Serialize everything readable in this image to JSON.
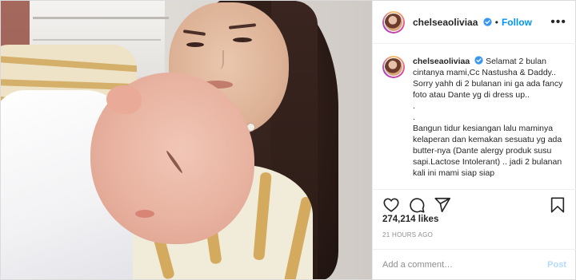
{
  "post": {
    "username": "chelseaoliviaa",
    "verified": true,
    "follow_label": "Follow",
    "separator": "•",
    "more_label": "•••",
    "caption_username": "chelseaoliviaa",
    "caption_text": "Selamat 2 bulan cintanya mami,Cc Nastusha & Daddy.. Sorry yahh di 2 bulanan ini ga ada fancy foto atau Dante yg di dress up..\n.\n.\nBangun tidur kesiangan lalu maminya kelaperan dan kemakan sesuatu yg ada butter-nya (Dante alergy produk susu sapi.Lactose Intolerant) .. jadi 2 bulanan kali ini mami siap siap",
    "likes": "274,214 likes",
    "time": "21 HOURS AGO",
    "comment_placeholder": "Add a comment…",
    "post_label": "Post"
  },
  "icons": [
    "heart-icon",
    "comment-icon",
    "share-icon",
    "bookmark-icon",
    "verified-badge-icon",
    "more-options-icon"
  ],
  "colors": {
    "accent": "#0095f6",
    "post_disabled": "#b3dbff",
    "text": "#262626",
    "muted": "#8e8e8e",
    "border": "#efefef"
  }
}
